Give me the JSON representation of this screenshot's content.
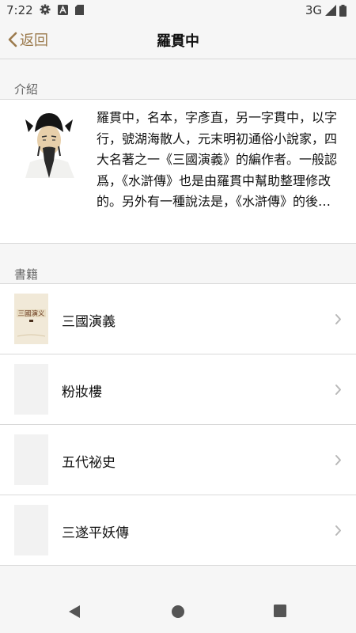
{
  "status": {
    "time": "7:22",
    "network": "3G",
    "icons": [
      "settings-icon",
      "font-a-icon",
      "sd-card-icon",
      "signal-icon",
      "battery-icon"
    ]
  },
  "nav": {
    "back_label": "返回",
    "title": "羅貫中"
  },
  "intro": {
    "header": "介紹",
    "text": "羅貫中，名本，字彥直，另一字貫中，以字行，號湖海散人，元末明初通俗小說家，四大名著之一《三國演義》的編作者。一般認爲，《水滸傳》也是由羅貫中幫助整理修改的。另外有一種說法是，《水滸傳》的後…"
  },
  "books": {
    "header": "書籍",
    "items": [
      {
        "title": "三國演義",
        "cover_text": "三國演义"
      },
      {
        "title": "粉妝樓"
      },
      {
        "title": "五代祕史"
      },
      {
        "title": "三遂平妖傳"
      }
    ]
  },
  "colors": {
    "accent": "#9b7a4c",
    "background": "#f6f6f6",
    "divider": "#d9d9d9"
  }
}
